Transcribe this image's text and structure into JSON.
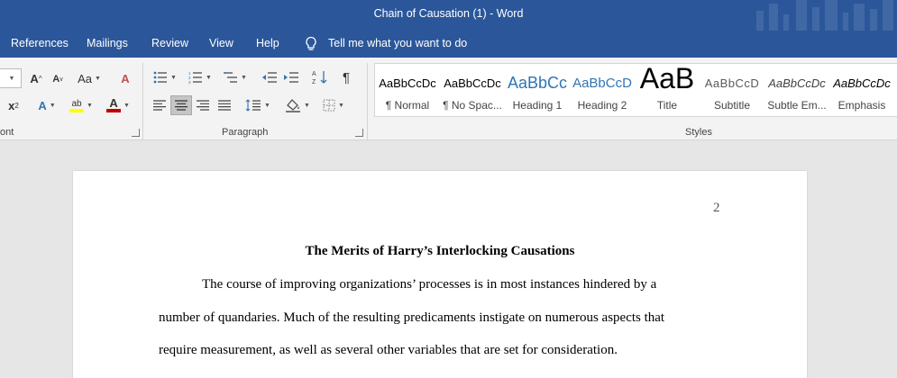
{
  "window": {
    "title": "Chain of Causation (1)  -  Word"
  },
  "tabs": [
    {
      "label": "References"
    },
    {
      "label": "Mailings"
    },
    {
      "label": "Review"
    },
    {
      "label": "View"
    },
    {
      "label": "Help"
    }
  ],
  "tell_me": {
    "label": "Tell me what you want to do",
    "icon": "lightbulb-icon"
  },
  "ribbon": {
    "font_group": {
      "label": "ont"
    },
    "paragraph_group": {
      "label": "Paragraph"
    },
    "styles_group": {
      "label": "Styles"
    },
    "styles": [
      {
        "preview": "AaBbCcDc",
        "name": "¶ Normal"
      },
      {
        "preview": "AaBbCcDc",
        "name": "¶ No Spac..."
      },
      {
        "preview": "AaBbCc",
        "name": "Heading 1"
      },
      {
        "preview": "AaBbCcD",
        "name": "Heading 2"
      },
      {
        "preview": "AaB",
        "name": "Title"
      },
      {
        "preview": "AaBbCcD",
        "name": "Subtitle"
      },
      {
        "preview": "AaBbCcDc",
        "name": "Subtle Em..."
      },
      {
        "preview": "AaBbCcDc",
        "name": "Emphasis"
      }
    ],
    "colors": {
      "highlight": "#ffff00",
      "font_color": "#c00000"
    }
  },
  "document": {
    "page_number": "2",
    "title": "The Merits of Harry’s Interlocking Causations",
    "lines": [
      "The course of improving organizations’ processes is in most instances hindered by a",
      "number of quandaries. Much of the resulting predicaments instigate on numerous aspects that",
      "require measurement, as well as several other variables that are set for consideration."
    ]
  }
}
